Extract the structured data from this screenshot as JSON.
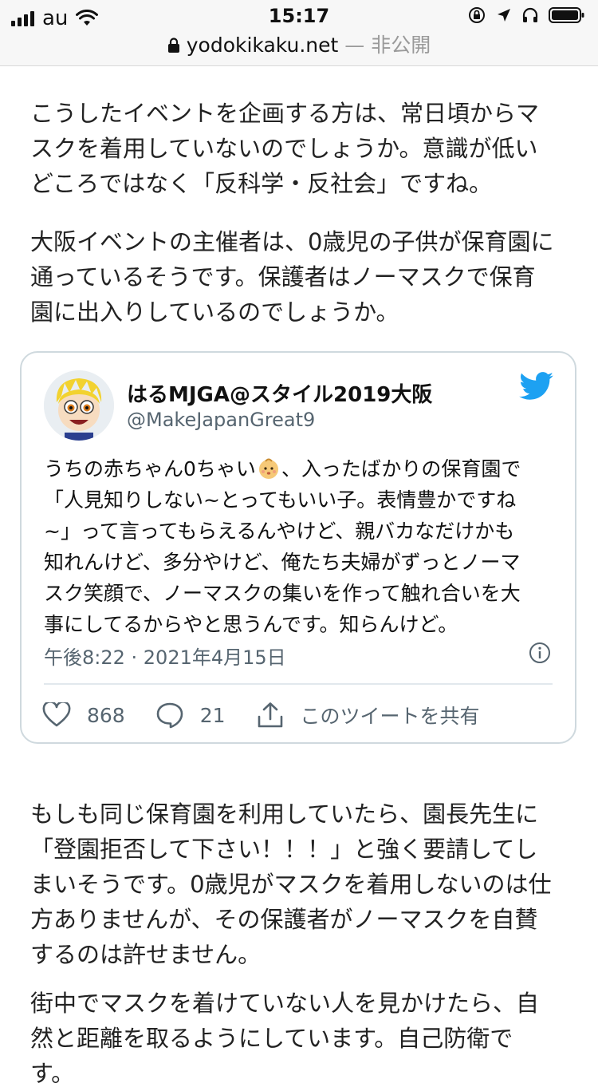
{
  "status_bar": {
    "carrier": "au",
    "time": "15:17"
  },
  "url_bar": {
    "host": "yodokikaku.net",
    "privacy": " — 非公開"
  },
  "article": {
    "paragraphs": [
      "こうしたイベントを企画する方は、常日頃からマ\nスクを着用していないのでしょうか。意識が低い\nどころではなく「反科学・反社会」ですね。",
      "大阪イベントの主催者は、0歳児の子供が保育園に\n通っているそうです。保護者はノーマスクで保育\n園に出入りしているのでしょうか。",
      "もしも同じ保育園を利用していたら、園長先生に\n「登園拒否して下さい！！！」と強く要請してし\nまいそうです。0歳児がマスクを着用しないのは仕\n方ありませんが、その保護者がノーマスクを自賛\nするのは許せません。",
      "街中でマスクを着けていない人を見かけたら、自\n然と距離を取るようにしています。自己防衛で\nす。"
    ]
  },
  "tweet": {
    "name": "はるMJGA@スタイル2019大阪",
    "handle": "@MakeJapanGreat9",
    "text_before_emoji": "うちの赤ちゃん0ちゃい",
    "text_after_emoji": "、入ったばかりの保育園で\n「人見知りしない~とってもいい子。表情豊かですね\n~」って言ってもらえるんやけど、親バカなだけかも\n知れんけど、多分やけど、俺たち夫婦がずっとノーマ\nスク笑顔で、ノーマスクの集いを作って触れ合いを大\n事にしてるからやと思うんです。知らんけど。",
    "timestamp": "午後8:22 · 2021年4月15日",
    "likes": "868",
    "replies": "21",
    "share_label": "このツイートを共有"
  },
  "colors": {
    "twitter_blue": "#1da1f2",
    "meta_gray": "#566570",
    "card_border": "#cfd9de"
  }
}
